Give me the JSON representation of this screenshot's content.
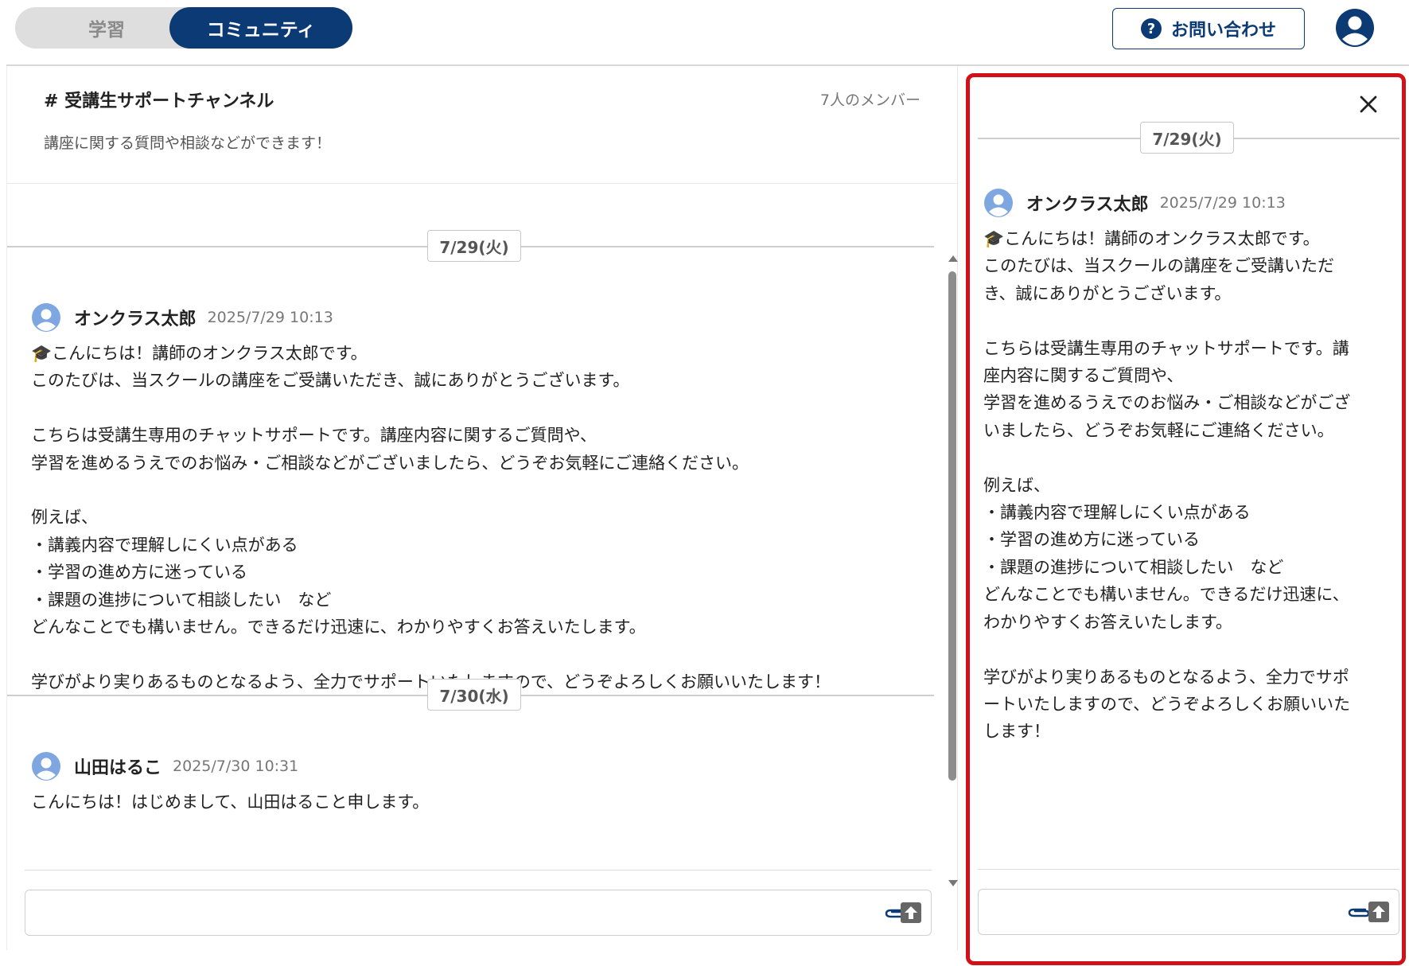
{
  "header": {
    "tabs": [
      {
        "label": "学習",
        "active": false
      },
      {
        "label": "コミュニティ",
        "active": true
      }
    ],
    "contact_button": {
      "icon": "help-circle-icon",
      "label": "お問い合わせ"
    },
    "account_icon": "account-circle-icon",
    "accent_color": "#0b3a74"
  },
  "channel": {
    "name": "# 受講生サポートチャンネル",
    "member_count": "7人のメンバー",
    "description": "講座に関する質問や相談などができます！"
  },
  "messages": {
    "date_1": "7/29(火)",
    "msg_1": {
      "author": "オンクラス太郎",
      "timestamp": "2025/7/29 10:13",
      "lines": [
        "🎓こんにちは！講師のオンクラス太郎です。",
        "このたびは、当スクールの講座をご受講いただき、誠にありがとうございます。",
        "",
        "こちらは受講生専用のチャットサポートです。講座内容に関するご質問や、",
        "学習を進めるうえでのお悩み・ご相談などがございましたら、どうぞお気軽にご連絡ください。",
        "",
        "例えば、",
        "・講義内容で理解しにくい点がある",
        "・学習の進め方に迷っている",
        "・課題の進捗について相談したい　など",
        "どんなことでも構いません。できるだけ迅速に、わかりやすくお答えいたします。",
        "",
        "学びがより実りあるものとなるよう、全力でサポートいたしますので、どうぞよろしくお願いいたします！"
      ]
    },
    "date_2": "7/30(水)",
    "msg_2": {
      "author": "山田はるこ",
      "timestamp": "2025/7/30 10:31",
      "lines": [
        "こんにちは！はじめまして、山田はること申します。"
      ]
    }
  },
  "composer": {
    "value": "",
    "attach_icon": "paperclip-icon",
    "send_icon": "send-arrow-up-icon"
  },
  "thread": {
    "close_icon": "close-x-icon",
    "date": "7/29(火)",
    "author": "オンクラス太郎",
    "timestamp": "2025/7/29 10:13",
    "lines": [
      "🎓こんにちは！講師のオンクラス太郎です。",
      "このたびは、当スクールの講座をご受講いただ",
      "き、誠にありがとうございます。",
      "",
      "こちらは受講生専用のチャットサポートです。講",
      "座内容に関するご質問や、",
      "学習を進めるうえでのお悩み・ご相談などがござ",
      "いましたら、どうぞお気軽にご連絡ください。",
      "",
      "例えば、",
      "・講義内容で理解しにくい点がある",
      "・学習の進め方に迷っている",
      "・課題の進捗について相談したい　など",
      "どんなことでも構いません。できるだけ迅速に、",
      "わかりやすくお答えいたします。",
      "",
      "学びがより実りあるものとなるよう、全力でサポ",
      "ートいたしますので、どうぞよろしくお願いいた",
      "します！"
    ],
    "composer_value": "",
    "highlight_color": "#d11018"
  }
}
